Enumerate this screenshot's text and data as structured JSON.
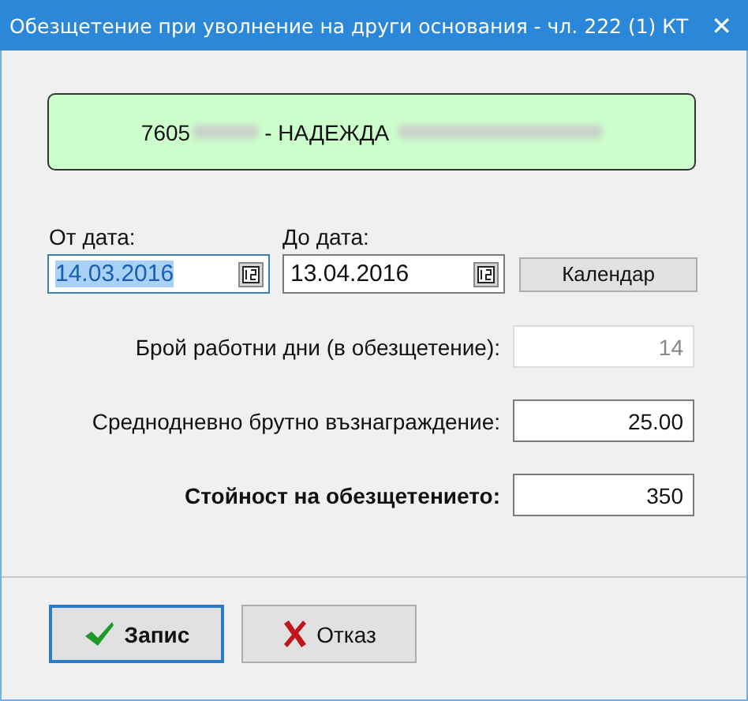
{
  "window": {
    "title": "Обезщетение при уволнение на други основания - чл. 222 (1) КТ",
    "close": "✕"
  },
  "employee": {
    "id": "7605",
    "name": "- НАДЕЖДА"
  },
  "dates": [
    {
      "label": "От дата:",
      "value": "14.03.2016",
      "selected": true
    },
    {
      "label": "До дата:",
      "value": "13.04.2016",
      "selected": false
    }
  ],
  "calendar_button": "Календар",
  "rows": [
    {
      "label": "Брой работни дни (в обезщетение):",
      "value": "14",
      "disabled": true,
      "kind": "normal"
    },
    {
      "label": "Среднодневно брутно възнаграждение:",
      "value": "25.00",
      "disabled": false,
      "kind": "normal"
    },
    {
      "label": "Стойност на обезщетението:",
      "value": "350",
      "disabled": false,
      "kind": "total"
    }
  ],
  "buttons": [
    {
      "label": "Запис",
      "kind": "ok",
      "selected": true
    },
    {
      "label": "Отказ",
      "kind": "cancel",
      "selected": false
    }
  ]
}
